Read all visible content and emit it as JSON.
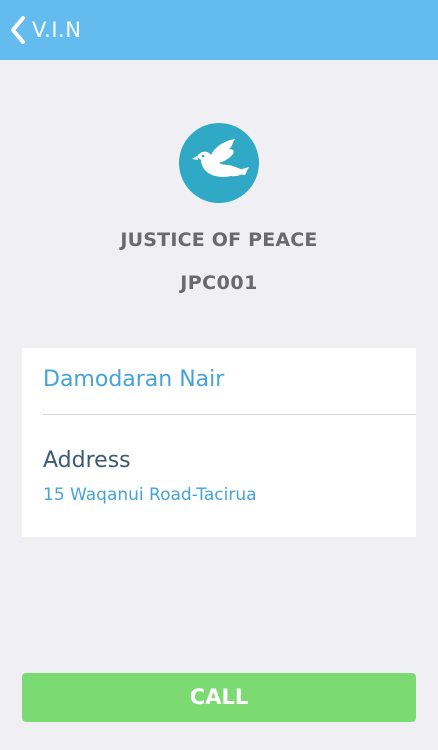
{
  "nav": {
    "back_label": "V.I.N",
    "back_icon": "chevron-left-icon"
  },
  "header": {
    "icon": "dove-icon",
    "title": "JUSTICE OF PEACE",
    "code": "JPC001"
  },
  "details": {
    "name": "Damodaran Nair",
    "address_label": "Address",
    "address_value": "15 Waqanui Road-Tacirua"
  },
  "actions": {
    "call_label": "CALL"
  },
  "colors": {
    "nav_bar": "#63bbee",
    "background": "#efeff4",
    "icon_circle": "#2fa9c5",
    "link_blue": "#45a3d6",
    "label_dark": "#3b5a75",
    "title_gray": "#6a6a6e",
    "call_green": "#7bdb72"
  }
}
